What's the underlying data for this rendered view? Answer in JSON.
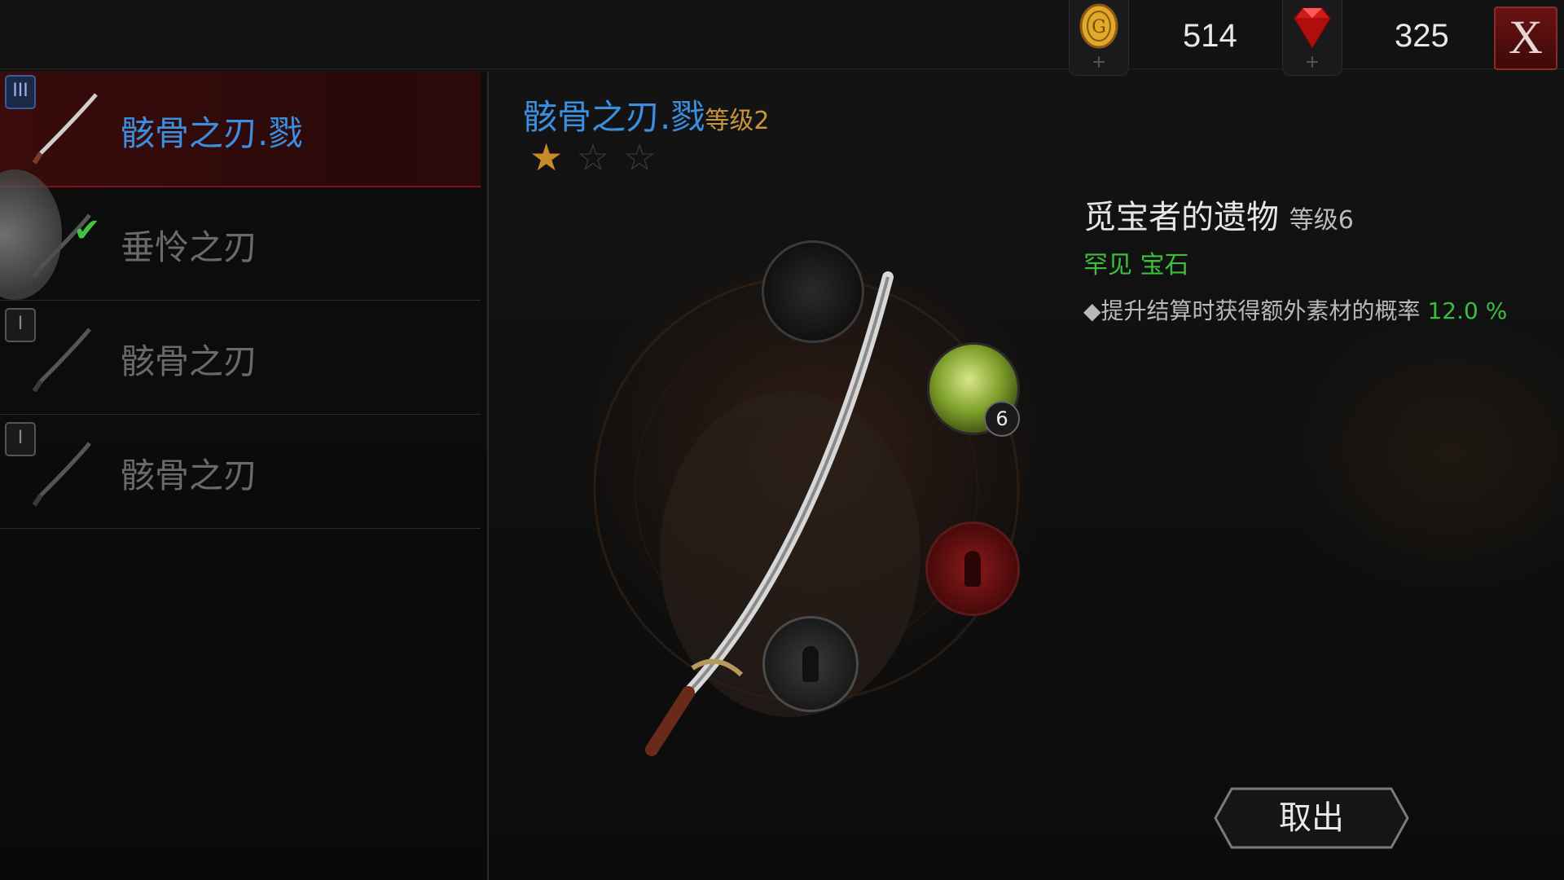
{
  "currency": {
    "gold": {
      "icon": "gold-coin-icon",
      "value": "514"
    },
    "gems": {
      "icon": "ruby-gem-icon",
      "value": "325"
    },
    "close_label": "X"
  },
  "weapon_list": {
    "items": [
      {
        "label": "骸骨之刃.戮",
        "selected": true
      },
      {
        "label": "垂怜之刃",
        "selected": false
      },
      {
        "label": "骸骨之刃",
        "selected": false
      },
      {
        "label": "骸骨之刃",
        "selected": false
      }
    ],
    "tiers": [
      "III",
      "I",
      "I"
    ]
  },
  "weapon": {
    "name": "骸骨之刃.戮",
    "level": "等级2",
    "stars_filled": 1,
    "stars_total": 3
  },
  "gem_slot": {
    "count": "6"
  },
  "gem_info": {
    "name": "觅宝者的遗物",
    "level": "等级6",
    "type": "罕见 宝石",
    "desc_prefix": "◆提升结算时获得额外素材的概率",
    "desc_value": "12.0 %"
  },
  "action": {
    "take_label": "取出"
  },
  "colors": {
    "selected_blue": "#3a8fe0",
    "gold": "#c7953a",
    "green": "#3dbd3d",
    "red": "#7a1414"
  }
}
